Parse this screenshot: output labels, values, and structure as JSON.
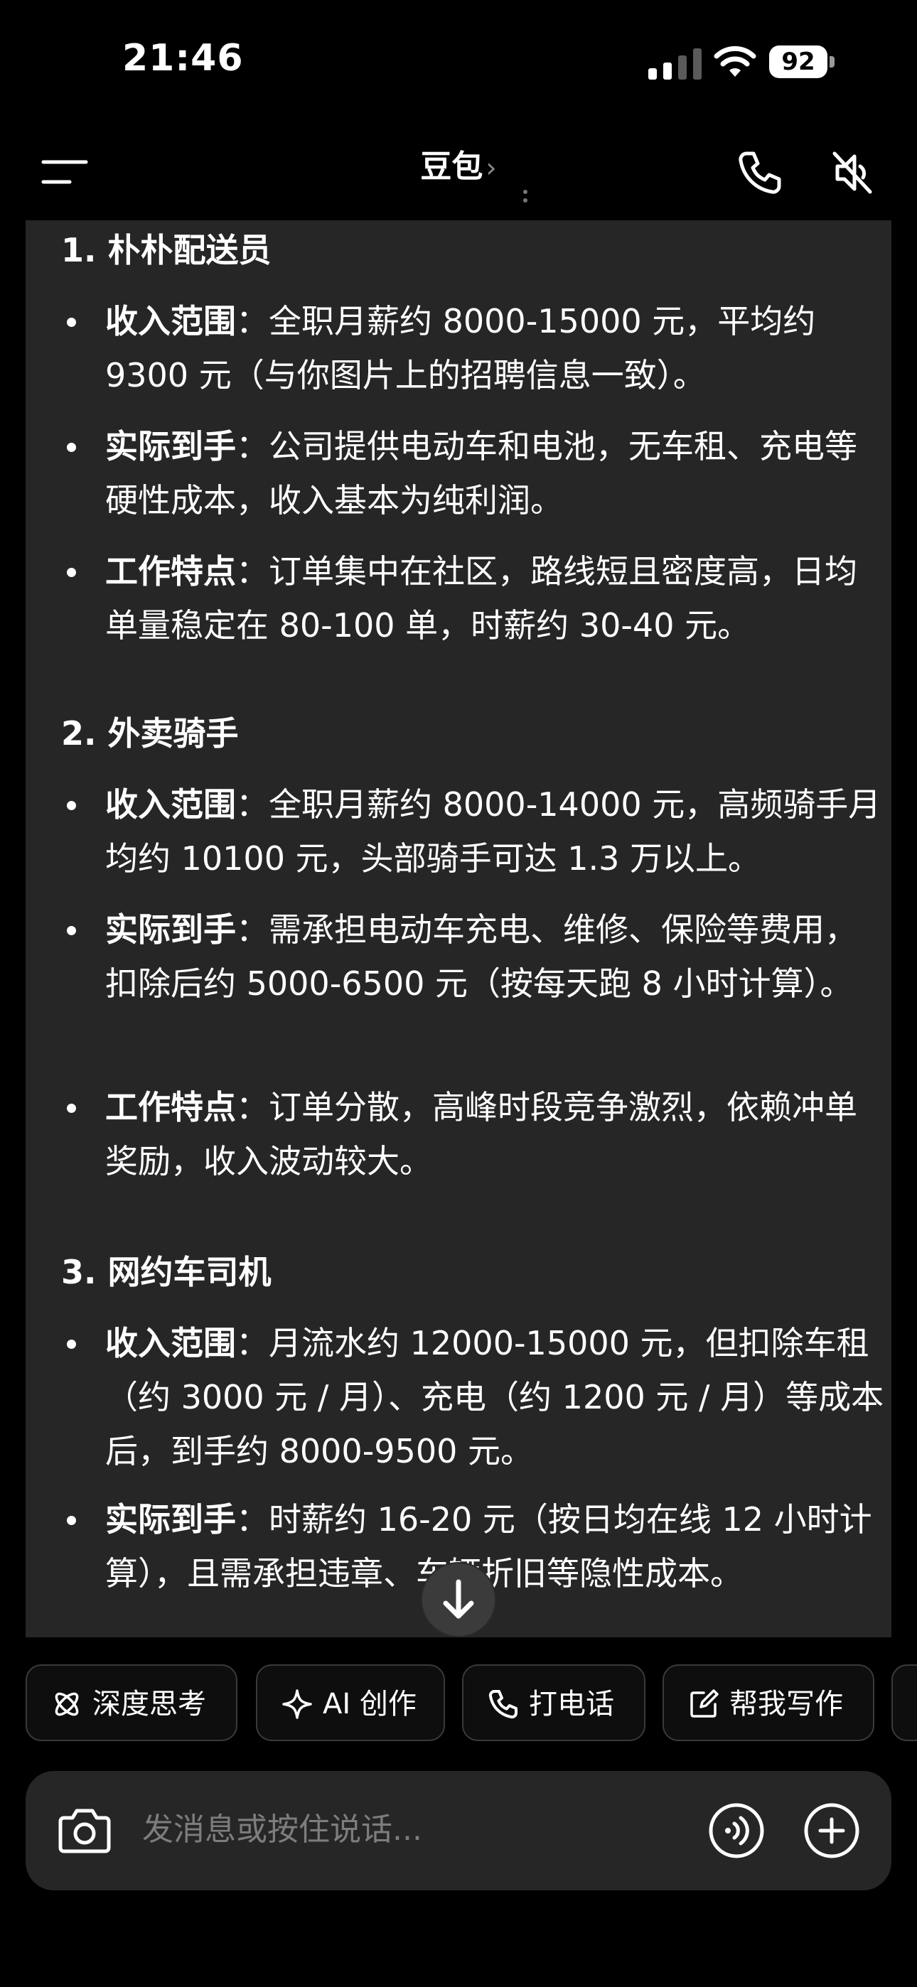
{
  "status_bar": {
    "time": "21:46",
    "battery": "92",
    "icons": [
      "signal-icon",
      "wifi-icon",
      "battery-icon"
    ]
  },
  "header": {
    "title": "豆包",
    "title_chevron": "›",
    "icons": [
      "menu-icon",
      "phone-icon",
      "speaker-mute-icon"
    ]
  },
  "message": {
    "sections": [
      {
        "title": "1. 朴朴配送员",
        "bullets": [
          {
            "label": "收入范围",
            "sep": "：",
            "text": "全职月薪约 8000-15000 元，平均约 9300 元（与你图片上的招聘信息一致）。"
          },
          {
            "label": "实际到手",
            "sep": "：",
            "text": "公司提供电动车和电池，无车租、充电等硬性成本，收入基本为纯利润。"
          },
          {
            "label": "工作特点",
            "sep": "：",
            "text": "订单集中在社区，路线短且密度高，日均单量稳定在 80-100 单，时薪约 30-40 元。"
          }
        ]
      },
      {
        "title": "2. 外卖骑手",
        "bullets": [
          {
            "label": "收入范围",
            "sep": "：",
            "text": "全职月薪约 8000-14000 元，高频骑手月均约 10100 元，头部骑手可达 1.3 万以上。"
          },
          {
            "label": "实际到手",
            "sep": "：",
            "text": "需承担电动车充电、维修、保险等费用，扣除后约 5000-6500 元（按每天跑 8 小时计算）。"
          },
          {
            "label": "工作特点",
            "sep": "：",
            "text": "订单分散，高峰时段竞争激烈，依赖冲单奖励，收入波动较大。"
          }
        ]
      },
      {
        "title": "3. 网约车司机",
        "bullets": [
          {
            "label": "收入范围",
            "sep": "：",
            "text": "月流水约 12000-15000 元，但扣除车租（约 3000 元 / 月）、充电（约 1200 元 / 月）等成本后，到手约 8000-9500 元。"
          },
          {
            "label": "实际到手",
            "sep": "：",
            "text": "时薪约 16-20 元（按日均在线 12 小时计算），且需承担违章、车辆折旧等隐性成本。"
          }
        ]
      }
    ]
  },
  "quick_actions": [
    {
      "label": "深度思考",
      "icon": "atom-icon"
    },
    {
      "label": "AI 创作",
      "icon": "sparkle-icon"
    },
    {
      "label": "打电话",
      "icon": "phone-icon"
    },
    {
      "label": "帮我写作",
      "icon": "edit-icon"
    }
  ],
  "input": {
    "placeholder": "发消息或按住说话...",
    "icons": [
      "camera-icon",
      "voice-wave-icon",
      "plus-icon"
    ]
  }
}
